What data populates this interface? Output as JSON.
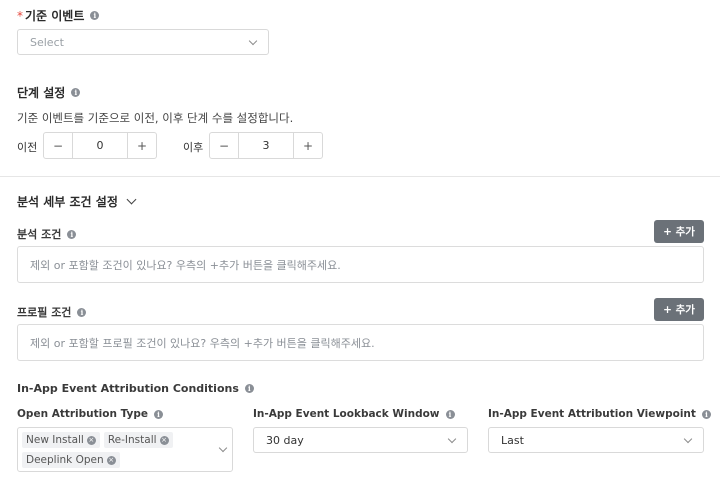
{
  "base_event": {
    "required_mark": "*",
    "label": "기준 이벤트",
    "placeholder": "Select"
  },
  "steps": {
    "title": "단계 설정",
    "description": "기준 이벤트를 기준으로 이전, 이후 단계 수를 설정합니다.",
    "before": {
      "label": "이전",
      "minus": "−",
      "value": "0",
      "plus": "+"
    },
    "after": {
      "label": "이후",
      "minus": "−",
      "value": "3",
      "plus": "+"
    }
  },
  "analysis_section": {
    "title": "분석 세부 조건 설정",
    "analysis_condition": {
      "label": "분석 조건",
      "add_button": "+ 추가",
      "placeholder": "제외 or 포함할 조건이 있나요? 우측의 +추가 버튼을 클릭해주세요."
    },
    "profile_condition": {
      "label": "프로필 조건",
      "add_button": "+ 추가",
      "placeholder": "제외 or 포함할 프로필 조건이 있나요? 우측의 +추가 버튼을 클릭해주세요."
    }
  },
  "attribution": {
    "title": "In-App Event Attribution Conditions",
    "open_type": {
      "label": "Open Attribution Type",
      "tags": [
        "New Install",
        "Re-Install",
        "Deeplink Open"
      ]
    },
    "lookback": {
      "label": "In-App Event Lookback Window",
      "value": "30 day"
    },
    "viewpoint": {
      "label": "In-App Event Attribution Viewpoint",
      "value": "Last"
    }
  },
  "icons": {
    "info": "i",
    "tag_remove": "×"
  }
}
